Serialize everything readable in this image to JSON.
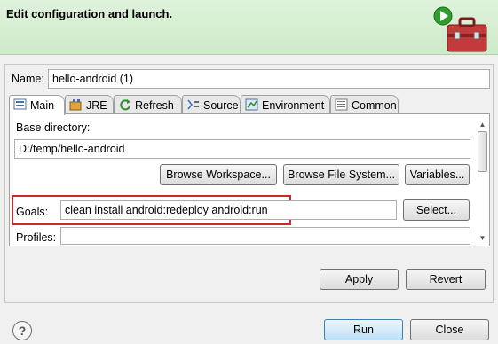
{
  "header": {
    "title": "Edit configuration and launch."
  },
  "name": {
    "label": "Name:",
    "value": "hello-android (1)"
  },
  "tabs": [
    {
      "label": "Main",
      "icon": "main-tab-icon"
    },
    {
      "label": "JRE",
      "icon": "jre-icon"
    },
    {
      "label": "Refresh",
      "icon": "refresh-icon"
    },
    {
      "label": "Source",
      "icon": "source-icon"
    },
    {
      "label": "Environment",
      "icon": "environment-icon"
    },
    {
      "label": "Common",
      "icon": "common-icon"
    }
  ],
  "main": {
    "base_dir_label": "Base directory:",
    "base_dir_value": "D:/temp/hello-android",
    "browse_workspace": "Browse Workspace...",
    "browse_fs": "Browse File System...",
    "variables": "Variables...",
    "goals_label": "Goals:",
    "goals_value": "clean install android:redeploy android:run",
    "select": "Select...",
    "profiles_label": "Profiles:",
    "profiles_value": ""
  },
  "buttons": {
    "apply": "Apply",
    "revert": "Revert",
    "run": "Run",
    "close": "Close"
  },
  "help": "?"
}
